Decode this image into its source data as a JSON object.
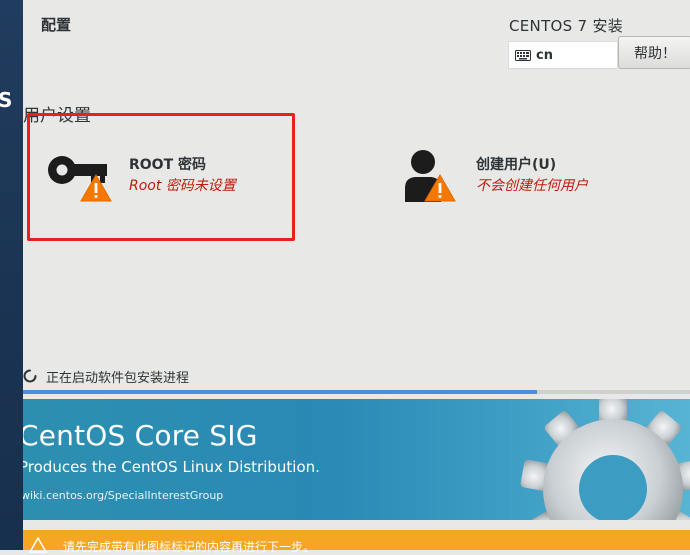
{
  "header": {
    "config_title": "配置",
    "install_title": "CENTOS 7 安装",
    "keyboard_layout": "cn",
    "help_label": "帮助！"
  },
  "sidebar": {
    "partial_letter": "S"
  },
  "user_settings": {
    "section_label": "用户设置",
    "root": {
      "title": "ROOT 密码",
      "status": "Root 密码未设置"
    },
    "user": {
      "title": "创建用户(U)",
      "status": "不会创建任何用户"
    }
  },
  "progress": {
    "text": "正在启动软件包安装进程",
    "fraction": 0.77
  },
  "banner": {
    "title": "CentOS Core SIG",
    "subtitle": "Produces the CentOS Linux Distribution.",
    "url": "wiki.centos.org/SpecialInterestGroup"
  },
  "warning": {
    "text": "请先完成带有此图标标记的内容再进行下一步。"
  },
  "colors": {
    "accent_blue": "#4a90d9",
    "warning_orange": "#f5a623",
    "error_red": "#c01c0c",
    "highlight_frame": "#e8211f"
  }
}
